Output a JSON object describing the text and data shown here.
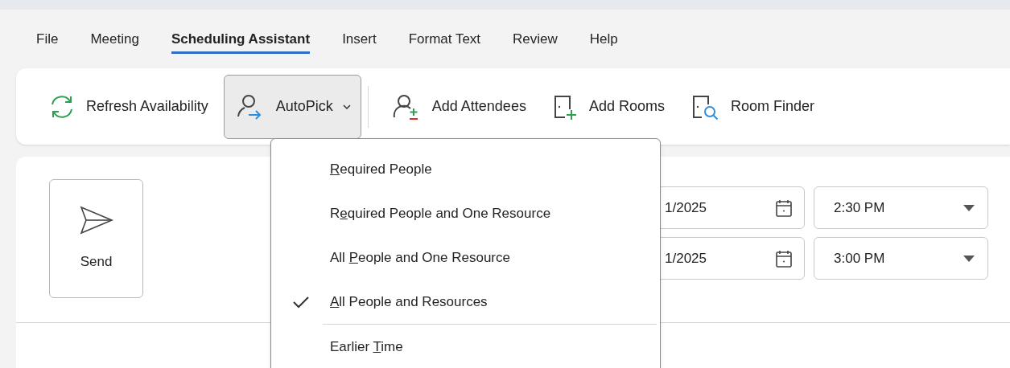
{
  "tabs": [
    {
      "label": "File",
      "selected": false
    },
    {
      "label": "Meeting",
      "selected": false
    },
    {
      "label": "Scheduling Assistant",
      "selected": true
    },
    {
      "label": "Insert",
      "selected": false
    },
    {
      "label": "Format Text",
      "selected": false
    },
    {
      "label": "Review",
      "selected": false
    },
    {
      "label": "Help",
      "selected": false
    }
  ],
  "ribbon": [
    {
      "kind": "refresh",
      "label": "Refresh Availability",
      "pressed": false,
      "dropdown": false
    },
    {
      "kind": "autopick",
      "label": "AutoPick",
      "pressed": true,
      "dropdown": true
    },
    {
      "kind": "attendees",
      "label": "Add Attendees",
      "pressed": false,
      "dropdown": false
    },
    {
      "kind": "rooms",
      "label": "Add Rooms",
      "pressed": false,
      "dropdown": false
    },
    {
      "kind": "finder",
      "label": "Room Finder",
      "pressed": false,
      "dropdown": false
    }
  ],
  "send_button": {
    "label": "Send"
  },
  "start": {
    "date": "1/2025",
    "time": "2:30 PM"
  },
  "end": {
    "date": "1/2025",
    "time": "3:00 PM"
  },
  "autopick_menu": {
    "groups": [
      [
        {
          "key": "R",
          "after": "equired People",
          "checked": false
        },
        {
          "before": "R",
          "key": "e",
          "after": "quired People and One Resource",
          "checked": false
        },
        {
          "before": "All ",
          "key": "P",
          "after": "eople and One Resource",
          "checked": false
        },
        {
          "key": "A",
          "after": "ll People and Resources",
          "checked": true
        }
      ],
      [
        {
          "before": "Earlier ",
          "key": "T",
          "after": "ime",
          "checked": false
        }
      ]
    ]
  }
}
